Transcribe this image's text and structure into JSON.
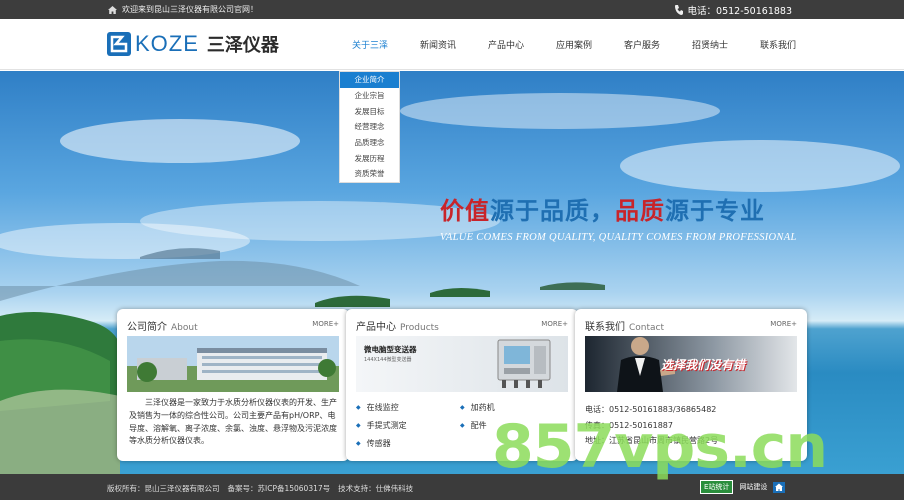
{
  "topbar": {
    "welcome": "欢迎来到昆山三泽仪器有限公司官网！",
    "phone": "电话：0512-50161883"
  },
  "logo": {
    "en": "KOZE",
    "cn": "三泽仪器"
  },
  "nav": [
    {
      "label": "关于三泽"
    },
    {
      "label": "新闻资讯"
    },
    {
      "label": "产品中心"
    },
    {
      "label": "应用案例"
    },
    {
      "label": "客户服务"
    },
    {
      "label": "招贤纳士"
    },
    {
      "label": "联系我们"
    }
  ],
  "dropdown": [
    {
      "label": "企业简介"
    },
    {
      "label": "企业宗旨"
    },
    {
      "label": "发展目标"
    },
    {
      "label": "经营理念"
    },
    {
      "label": "品质理念"
    },
    {
      "label": "发展历程"
    },
    {
      "label": "资质荣誉"
    }
  ],
  "hero": {
    "slogan_1": "价值",
    "slogan_2": "源于品质，",
    "slogan_3": "品质",
    "slogan_4": "源于专业",
    "slogan_en": "VALUE COMES FROM QUALITY, QUALITY COMES FROM PROFESSIONAL"
  },
  "cards": {
    "about": {
      "title": "公司简介",
      "title_en": "About",
      "more": "MORE+",
      "text": "三泽仪器是一家致力于水质分析仪器仪表的开发、生产及销售为一体的综合性公司。公司主要产品有pH/ORP、电导度、溶解氧、离子浓度、余氯、浊度、悬浮物及污泥浓度等水质分析仪器仪表。"
    },
    "products": {
      "title": "产品中心",
      "title_en": "Products",
      "more": "MORE+",
      "banner_title": "微电脑型变送器",
      "banner_sub": "144X144微型变送器",
      "links": [
        "在线监控",
        "加药机",
        "手提式测定",
        "配件",
        "传感器"
      ]
    },
    "contact": {
      "title": "联系我们",
      "title_en": "Contact",
      "more": "MORE+",
      "banner_text": "选择我们没有错",
      "phone": "电话：0512-50161883/36865482",
      "fax": "传真：0512-50161887",
      "address": "地址：江苏省昆山市周市镇民营路2号"
    }
  },
  "footer": {
    "copyright": "版权所有：昆山三泽仪器有限公司",
    "icp": "备案号：苏ICP备15060317号",
    "support": "技术支持：仕佛伟科技",
    "badge1": "E站统计",
    "badge2": "网站建设"
  },
  "watermark": "857vps.cn",
  "colors": {
    "accent": "#1a7fd0",
    "brand_red": "#c8242a",
    "topbar": "#3d3d3d"
  }
}
